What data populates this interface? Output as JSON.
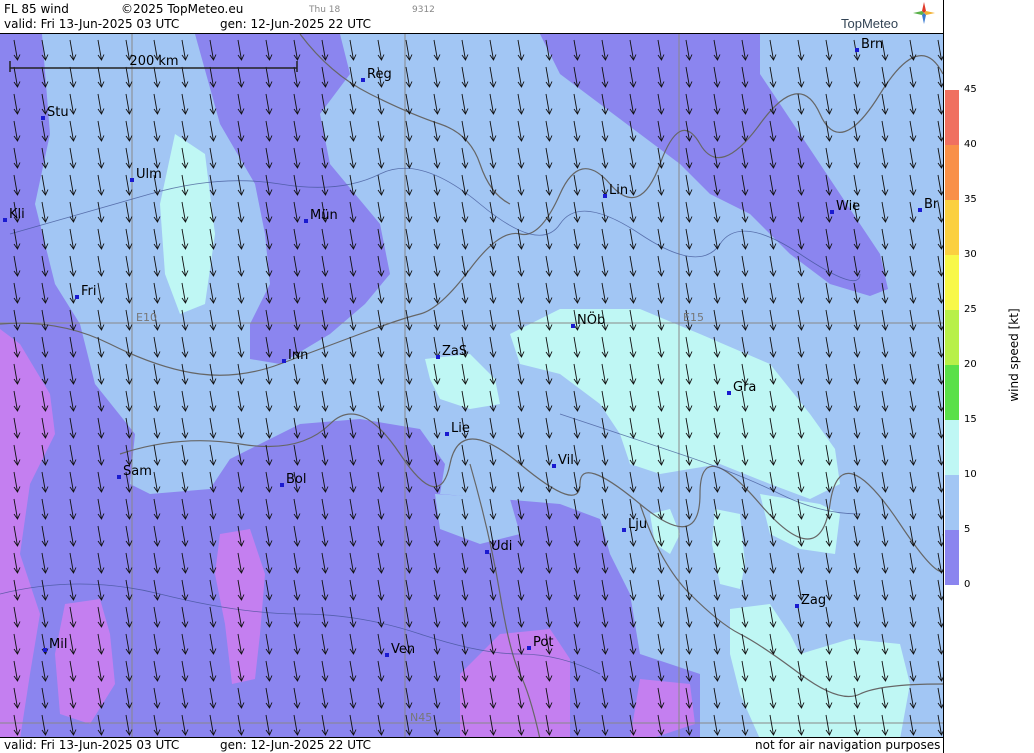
{
  "header": {
    "product": "FL 85 wind",
    "copyright": "©2025 TopMeteo.eu",
    "valid": "valid:  Fri  13-Jun-2025  03 UTC",
    "gen": "gen: 12-Jun-2025 22 UTC",
    "small_day": "Thu 18",
    "small_code": "9312",
    "brand": "TopMeteo"
  },
  "footer": {
    "valid": "valid:  Fri  13-Jun-2025  03 UTC",
    "gen": "gen: 12-Jun-2025 22 UTC",
    "disclaimer": "not for air navigation purposes"
  },
  "map": {
    "scale_label": "200 km",
    "grid_labels": {
      "e10": "E10",
      "e15": "E15",
      "n45": "N45"
    },
    "cities": [
      {
        "name": "Stu"
      },
      {
        "name": "Ulm"
      },
      {
        "name": "Reg"
      },
      {
        "name": "Brn"
      },
      {
        "name": "Kli"
      },
      {
        "name": "Mün"
      },
      {
        "name": "Lin"
      },
      {
        "name": "Wie"
      },
      {
        "name": "Br"
      },
      {
        "name": "Fri"
      },
      {
        "name": "NÖb"
      },
      {
        "name": "Inn"
      },
      {
        "name": "ZaS"
      },
      {
        "name": "Gra"
      },
      {
        "name": "Lie"
      },
      {
        "name": "Vil"
      },
      {
        "name": "Sam"
      },
      {
        "name": "Bol"
      },
      {
        "name": "Lju"
      },
      {
        "name": "Udi"
      },
      {
        "name": "Zag"
      },
      {
        "name": "Mil"
      },
      {
        "name": "Ven"
      },
      {
        "name": "Pot"
      }
    ],
    "wind_direction_note": "arrows point south-southeast",
    "colors": {
      "wind_5_10": "#8b85ef",
      "wind_0_5": "#c47ff0",
      "wind_10_15": "#a2c6f4",
      "wind_15_20": "#bff7f4"
    }
  },
  "colorbar": {
    "title": "wind speed  [kt]",
    "ticks": [
      "45",
      "40",
      "35",
      "30",
      "25",
      "20",
      "15",
      "10",
      "5",
      "0"
    ],
    "colors": [
      "#f07060",
      "#f99048",
      "#fbd040",
      "#f8f848",
      "#b8f048",
      "#5ae048",
      "#bff7f4",
      "#a2c6f4",
      "#8b85ef",
      "#c47ff0"
    ]
  }
}
